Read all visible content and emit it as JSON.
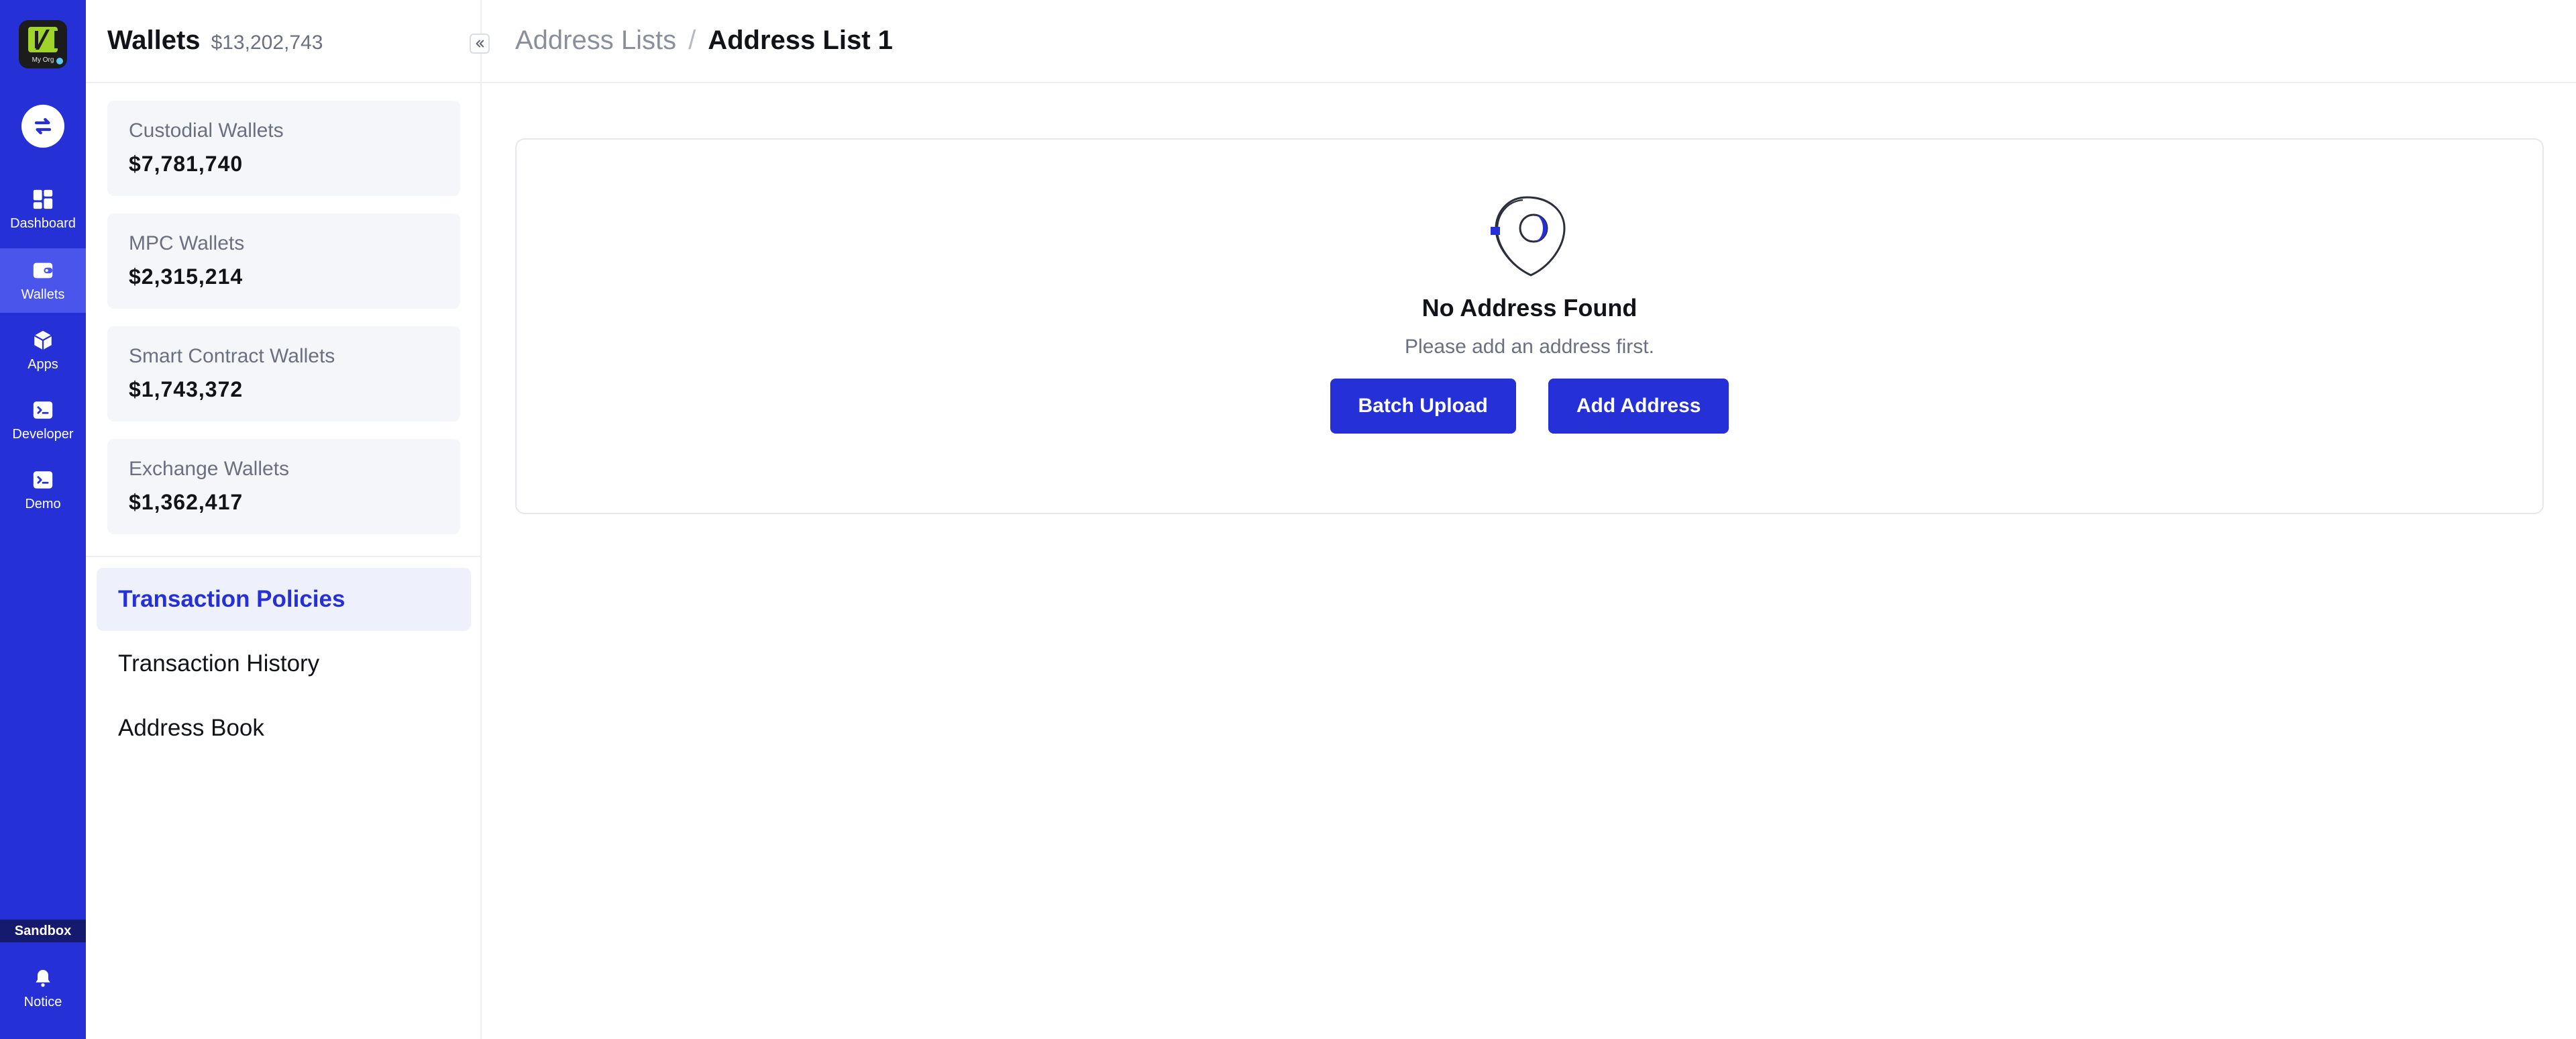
{
  "rail": {
    "org_label": "My Org",
    "items": [
      {
        "label": "Dashboard",
        "icon": "grid-icon"
      },
      {
        "label": "Wallets",
        "icon": "wallet-icon",
        "active": true
      },
      {
        "label": "Apps",
        "icon": "cube-icon"
      },
      {
        "label": "Developer",
        "icon": "terminal-icon"
      },
      {
        "label": "Demo",
        "icon": "terminal-icon"
      }
    ],
    "sandbox_label": "Sandbox",
    "notice_label": "Notice"
  },
  "sidebar": {
    "title": "Wallets",
    "total": "$13,202,743",
    "wallets": [
      {
        "name": "Custodial Wallets",
        "amount": "$7,781,740"
      },
      {
        "name": "MPC Wallets",
        "amount": "$2,315,214"
      },
      {
        "name": "Smart Contract Wallets",
        "amount": "$1,743,372"
      },
      {
        "name": "Exchange Wallets",
        "amount": "$1,362,417"
      }
    ],
    "nav": [
      {
        "label": "Transaction Policies",
        "active": true
      },
      {
        "label": "Transaction History"
      },
      {
        "label": "Address Book"
      }
    ]
  },
  "breadcrumb": {
    "parent": "Address Lists",
    "separator": "/",
    "current": "Address List 1"
  },
  "empty_state": {
    "title": "No Address Found",
    "subtitle": "Please add an address first.",
    "batch_upload_label": "Batch Upload",
    "add_address_label": "Add Address"
  },
  "colors": {
    "brand": "#2530d6",
    "active_nav_bg": "#eef0fb"
  }
}
